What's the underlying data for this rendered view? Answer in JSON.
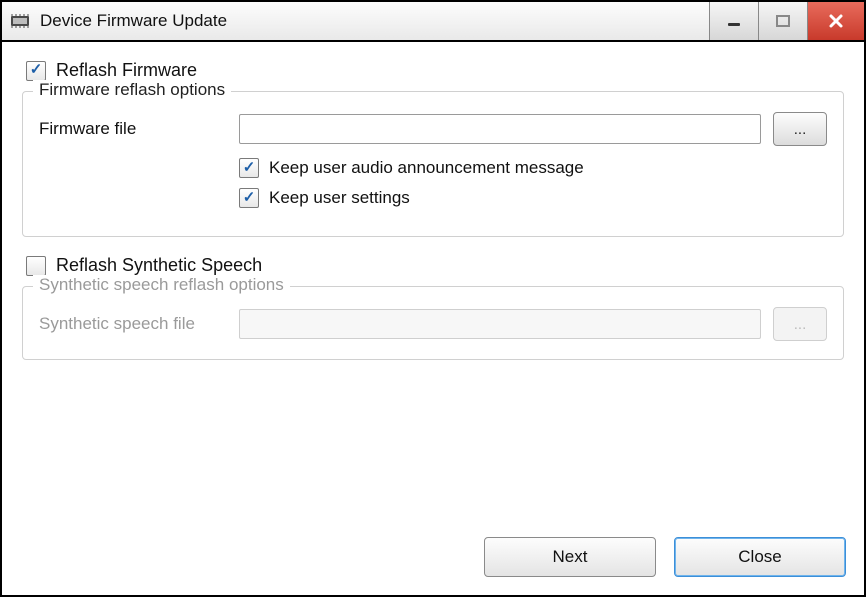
{
  "window": {
    "title": "Device Firmware Update"
  },
  "reflash_firmware": {
    "label": "Reflash Firmware",
    "checked": true
  },
  "firmware_group": {
    "legend": "Firmware reflash options",
    "file_label": "Firmware file",
    "file_value": "",
    "browse_label": "...",
    "keep_audio": {
      "label": "Keep user audio announcement message",
      "checked": true
    },
    "keep_settings": {
      "label": "Keep user settings",
      "checked": true
    }
  },
  "reflash_speech": {
    "label": "Reflash Synthetic Speech",
    "checked": false
  },
  "speech_group": {
    "legend": "Synthetic speech reflash options",
    "file_label": "Synthetic speech file",
    "file_value": "",
    "browse_label": "...",
    "enabled": false
  },
  "footer": {
    "next": "Next",
    "close": "Close"
  }
}
